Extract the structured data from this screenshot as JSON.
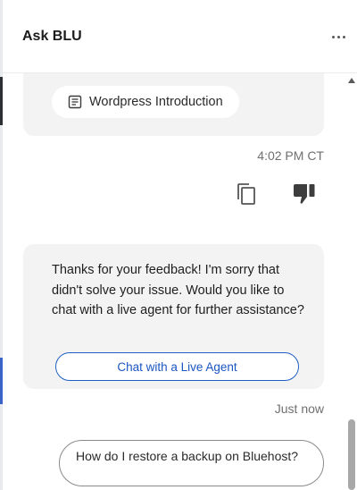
{
  "header": {
    "title": "Ask BLU",
    "more_icon": "more-horizontal-icon"
  },
  "previous_answer": {
    "source_link": "Wordpress Introduction",
    "source_icon": "document-icon",
    "timestamp": "4:02 PM CT",
    "actions": [
      {
        "name": "copy",
        "icon": "copy-icon"
      },
      {
        "name": "dislike",
        "icon": "thumbs-down-icon",
        "state": "selected"
      }
    ]
  },
  "feedback_message": {
    "text": "Thanks for your feedback! I'm sorry that didn't solve your issue. Would you like to chat with a live agent for further assistance?",
    "button_label": "Chat with a Live Agent",
    "timestamp": "Just now"
  },
  "suggestion": {
    "text": "How do I restore a backup on Bluehost?"
  },
  "colors": {
    "accent": "#1f5fc4",
    "bubble_bg": "#f3f3f4",
    "muted_text": "#6f6f6f"
  }
}
